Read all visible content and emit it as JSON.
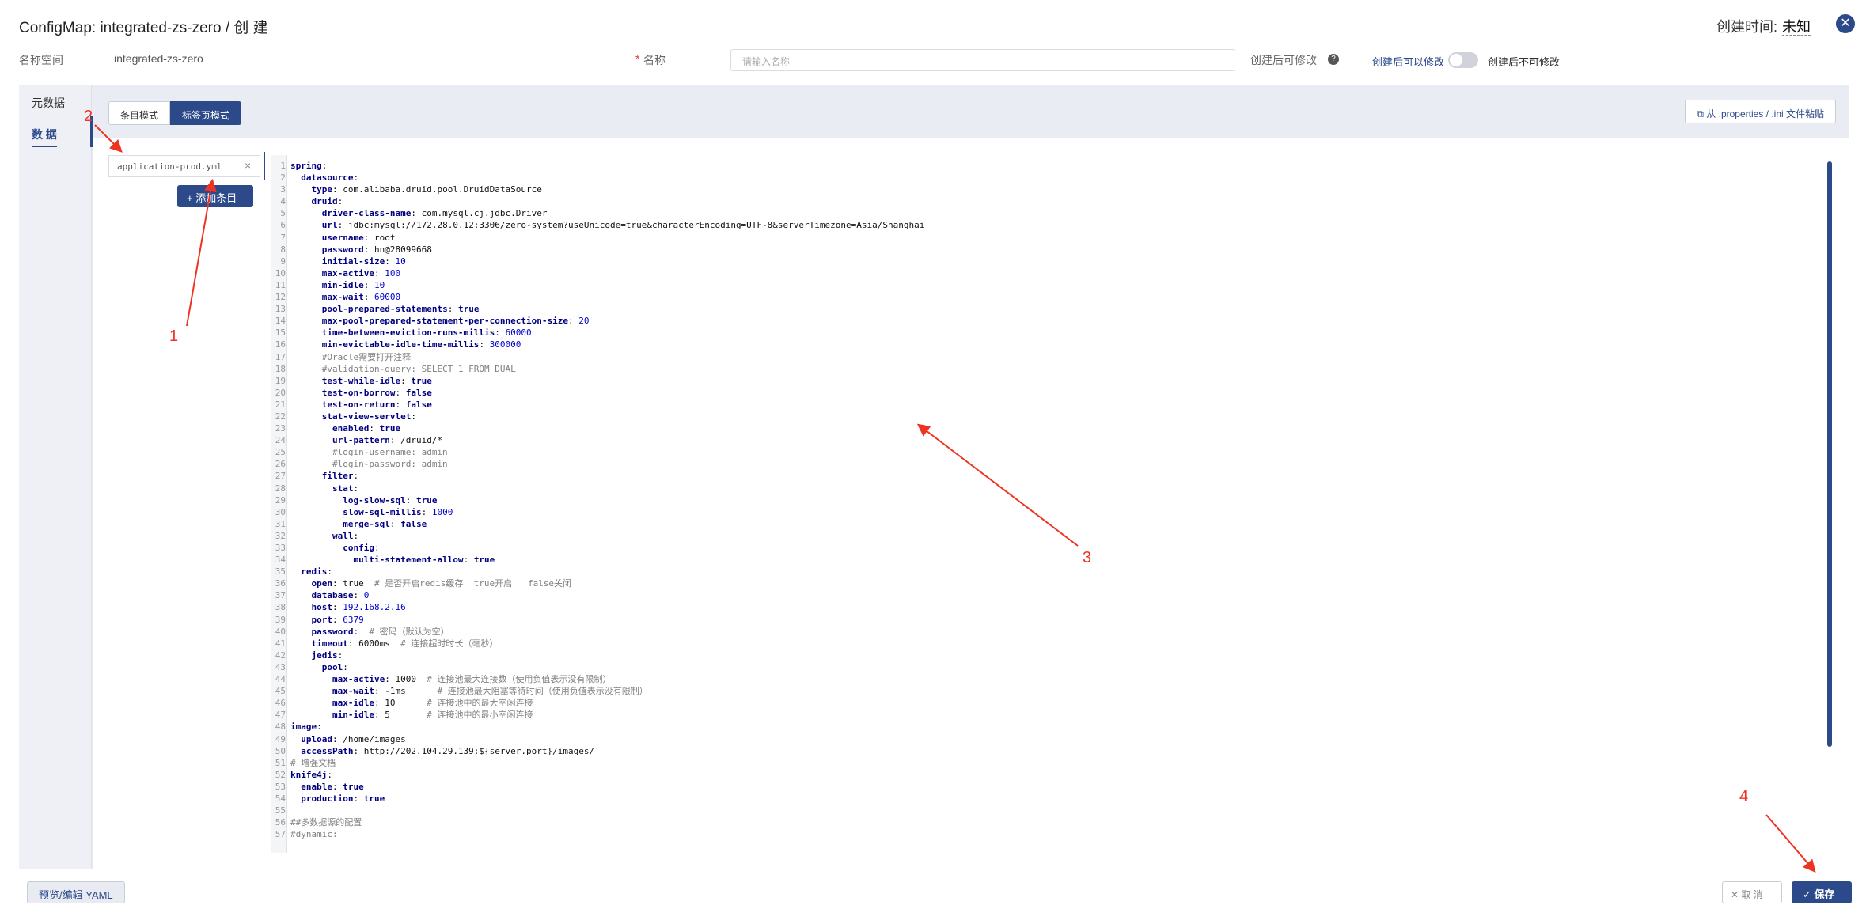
{
  "header": {
    "title": "ConfigMap: integrated-zs-zero / 创 建",
    "created_label": "创建时间:",
    "created_value": "未知"
  },
  "meta": {
    "namespace_label": "名称空间",
    "namespace_value": "integrated-zs-zero",
    "required_star": "*",
    "name_label": "名称",
    "name_placeholder": "请输入名称",
    "modifiable_label": "创建后可修改",
    "toggle_left": "创建后可以修改",
    "toggle_right": "创建后不可修改",
    "toggle_on": false
  },
  "sidebar": {
    "items": [
      {
        "label": "元数据"
      },
      {
        "label": "数 据"
      }
    ]
  },
  "toolbar": {
    "mode_item": "条目模式",
    "mode_tab": "标签页模式",
    "paste_label": "从 .properties / .ini 文件粘贴"
  },
  "file": {
    "name": "application-prod.yml",
    "add_label": "+ 添加条目"
  },
  "editor": {
    "lines": [
      [
        [
          "k",
          "spring"
        ],
        [
          "v",
          ":"
        ]
      ],
      [
        [
          "v",
          "  "
        ],
        [
          "k",
          "datasource"
        ],
        [
          "v",
          ":"
        ]
      ],
      [
        [
          "v",
          "    "
        ],
        [
          "k",
          "type"
        ],
        [
          "v",
          ": com.alibaba.druid.pool.DruidDataSource"
        ]
      ],
      [
        [
          "v",
          "    "
        ],
        [
          "k",
          "druid"
        ],
        [
          "v",
          ":"
        ]
      ],
      [
        [
          "v",
          "      "
        ],
        [
          "k",
          "driver-class-name"
        ],
        [
          "v",
          ": com.mysql.cj.jdbc.Driver"
        ]
      ],
      [
        [
          "v",
          "      "
        ],
        [
          "k",
          "url"
        ],
        [
          "v",
          ": jdbc:mysql://172.28.0.12:3306/zero-system?useUnicode=true&characterEncoding=UTF-8&serverTimezone=Asia/Shanghai"
        ]
      ],
      [
        [
          "v",
          "      "
        ],
        [
          "k",
          "username"
        ],
        [
          "v",
          ": root"
        ]
      ],
      [
        [
          "v",
          "      "
        ],
        [
          "k",
          "password"
        ],
        [
          "v",
          ": hn@28099668"
        ]
      ],
      [
        [
          "v",
          "      "
        ],
        [
          "k",
          "initial-size"
        ],
        [
          "v",
          ": "
        ],
        [
          "n",
          "10"
        ]
      ],
      [
        [
          "v",
          "      "
        ],
        [
          "k",
          "max-active"
        ],
        [
          "v",
          ": "
        ],
        [
          "n",
          "100"
        ]
      ],
      [
        [
          "v",
          "      "
        ],
        [
          "k",
          "min-idle"
        ],
        [
          "v",
          ": "
        ],
        [
          "n",
          "10"
        ]
      ],
      [
        [
          "v",
          "      "
        ],
        [
          "k",
          "max-wait"
        ],
        [
          "v",
          ": "
        ],
        [
          "n",
          "60000"
        ]
      ],
      [
        [
          "v",
          "      "
        ],
        [
          "k",
          "pool-prepared-statements"
        ],
        [
          "v",
          ": "
        ],
        [
          "k",
          "true"
        ]
      ],
      [
        [
          "v",
          "      "
        ],
        [
          "k",
          "max-pool-prepared-statement-per-connection-size"
        ],
        [
          "v",
          ": "
        ],
        [
          "n",
          "20"
        ]
      ],
      [
        [
          "v",
          "      "
        ],
        [
          "k",
          "time-between-eviction-runs-millis"
        ],
        [
          "v",
          ": "
        ],
        [
          "n",
          "60000"
        ]
      ],
      [
        [
          "v",
          "      "
        ],
        [
          "k",
          "min-evictable-idle-time-millis"
        ],
        [
          "v",
          ": "
        ],
        [
          "n",
          "300000"
        ]
      ],
      [
        [
          "v",
          "      "
        ],
        [
          "c",
          "#Oracle需要打开注释"
        ]
      ],
      [
        [
          "v",
          "      "
        ],
        [
          "c",
          "#validation-query: SELECT 1 FROM DUAL"
        ]
      ],
      [
        [
          "v",
          "      "
        ],
        [
          "k",
          "test-while-idle"
        ],
        [
          "v",
          ": "
        ],
        [
          "k",
          "true"
        ]
      ],
      [
        [
          "v",
          "      "
        ],
        [
          "k",
          "test-on-borrow"
        ],
        [
          "v",
          ": "
        ],
        [
          "k",
          "false"
        ]
      ],
      [
        [
          "v",
          "      "
        ],
        [
          "k",
          "test-on-return"
        ],
        [
          "v",
          ": "
        ],
        [
          "k",
          "false"
        ]
      ],
      [
        [
          "v",
          "      "
        ],
        [
          "k",
          "stat-view-servlet"
        ],
        [
          "v",
          ":"
        ]
      ],
      [
        [
          "v",
          "        "
        ],
        [
          "k",
          "enabled"
        ],
        [
          "v",
          ": "
        ],
        [
          "k",
          "true"
        ]
      ],
      [
        [
          "v",
          "        "
        ],
        [
          "k",
          "url-pattern"
        ],
        [
          "v",
          ": /druid/*"
        ]
      ],
      [
        [
          "v",
          "        "
        ],
        [
          "c",
          "#login-username: admin"
        ]
      ],
      [
        [
          "v",
          "        "
        ],
        [
          "c",
          "#login-password: admin"
        ]
      ],
      [
        [
          "v",
          "      "
        ],
        [
          "k",
          "filter"
        ],
        [
          "v",
          ":"
        ]
      ],
      [
        [
          "v",
          "        "
        ],
        [
          "k",
          "stat"
        ],
        [
          "v",
          ":"
        ]
      ],
      [
        [
          "v",
          "          "
        ],
        [
          "k",
          "log-slow-sql"
        ],
        [
          "v",
          ": "
        ],
        [
          "k",
          "true"
        ]
      ],
      [
        [
          "v",
          "          "
        ],
        [
          "k",
          "slow-sql-millis"
        ],
        [
          "v",
          ": "
        ],
        [
          "n",
          "1000"
        ]
      ],
      [
        [
          "v",
          "          "
        ],
        [
          "k",
          "merge-sql"
        ],
        [
          "v",
          ": "
        ],
        [
          "k",
          "false"
        ]
      ],
      [
        [
          "v",
          "        "
        ],
        [
          "k",
          "wall"
        ],
        [
          "v",
          ":"
        ]
      ],
      [
        [
          "v",
          "          "
        ],
        [
          "k",
          "config"
        ],
        [
          "v",
          ":"
        ]
      ],
      [
        [
          "v",
          "            "
        ],
        [
          "k",
          "multi-statement-allow"
        ],
        [
          "v",
          ": "
        ],
        [
          "k",
          "true"
        ]
      ],
      [
        [
          "v",
          "  "
        ],
        [
          "k",
          "redis"
        ],
        [
          "v",
          ":"
        ]
      ],
      [
        [
          "v",
          "    "
        ],
        [
          "k",
          "open"
        ],
        [
          "v",
          ": true  "
        ],
        [
          "c",
          "# 是否开启redis缓存  true开启   false关闭"
        ]
      ],
      [
        [
          "v",
          "    "
        ],
        [
          "k",
          "database"
        ],
        [
          "v",
          ": "
        ],
        [
          "n",
          "0"
        ]
      ],
      [
        [
          "v",
          "    "
        ],
        [
          "k",
          "host"
        ],
        [
          "v",
          ": "
        ],
        [
          "n",
          "192.168.2.16"
        ]
      ],
      [
        [
          "v",
          "    "
        ],
        [
          "k",
          "port"
        ],
        [
          "v",
          ": "
        ],
        [
          "n",
          "6379"
        ]
      ],
      [
        [
          "v",
          "    "
        ],
        [
          "k",
          "password"
        ],
        [
          "v",
          ":  "
        ],
        [
          "c",
          "# 密码（默认为空）"
        ]
      ],
      [
        [
          "v",
          "    "
        ],
        [
          "k",
          "timeout"
        ],
        [
          "v",
          ": 6000ms  "
        ],
        [
          "c",
          "# 连接超时时长（毫秒）"
        ]
      ],
      [
        [
          "v",
          "    "
        ],
        [
          "k",
          "jedis"
        ],
        [
          "v",
          ":"
        ]
      ],
      [
        [
          "v",
          "      "
        ],
        [
          "k",
          "pool"
        ],
        [
          "v",
          ":"
        ]
      ],
      [
        [
          "v",
          "        "
        ],
        [
          "k",
          "max-active"
        ],
        [
          "v",
          ": 1000  "
        ],
        [
          "c",
          "# 连接池最大连接数（使用负值表示没有限制）"
        ]
      ],
      [
        [
          "v",
          "        "
        ],
        [
          "k",
          "max-wait"
        ],
        [
          "v",
          ": -1ms      "
        ],
        [
          "c",
          "# 连接池最大阻塞等待时间（使用负值表示没有限制）"
        ]
      ],
      [
        [
          "v",
          "        "
        ],
        [
          "k",
          "max-idle"
        ],
        [
          "v",
          ": 10      "
        ],
        [
          "c",
          "# 连接池中的最大空闲连接"
        ]
      ],
      [
        [
          "v",
          "        "
        ],
        [
          "k",
          "min-idle"
        ],
        [
          "v",
          ": 5       "
        ],
        [
          "c",
          "# 连接池中的最小空闲连接"
        ]
      ],
      [
        [
          "k",
          "image"
        ],
        [
          "v",
          ":"
        ]
      ],
      [
        [
          "v",
          "  "
        ],
        [
          "k",
          "upload"
        ],
        [
          "v",
          ": /home/images"
        ]
      ],
      [
        [
          "v",
          "  "
        ],
        [
          "k",
          "accessPath"
        ],
        [
          "v",
          ": http://202.104.29.139:${server.port}/images/"
        ]
      ],
      [
        [
          "c",
          "# 增强文档"
        ]
      ],
      [
        [
          "k",
          "knife4j"
        ],
        [
          "v",
          ":"
        ]
      ],
      [
        [
          "v",
          "  "
        ],
        [
          "k",
          "enable"
        ],
        [
          "v",
          ": "
        ],
        [
          "k",
          "true"
        ]
      ],
      [
        [
          "v",
          "  "
        ],
        [
          "k",
          "production"
        ],
        [
          "v",
          ": "
        ],
        [
          "k",
          "true"
        ]
      ],
      [
        [
          "v",
          ""
        ]
      ],
      [
        [
          "c",
          "##多数据源的配置"
        ]
      ],
      [
        [
          "c",
          "#dynamic:"
        ]
      ]
    ]
  },
  "footer": {
    "yaml_label": "预览/编辑 YAML",
    "cancel_label": "✕ 取 消",
    "save_label": "✓ 保存"
  },
  "annotations": [
    "1",
    "2",
    "3",
    "4"
  ],
  "colors": {
    "primary": "#2c4a8a",
    "annotation": "#e32222"
  }
}
